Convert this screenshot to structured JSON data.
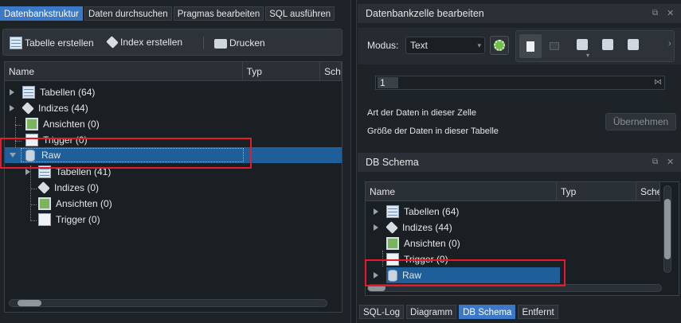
{
  "left": {
    "tabs": [
      "Datenbankstruktur",
      "Daten durchsuchen",
      "Pragmas bearbeiten",
      "SQL ausführen"
    ],
    "toolbar": {
      "create_table": "Tabelle erstellen",
      "create_index": "Index erstellen",
      "print": "Drucken"
    },
    "columns": [
      "Name",
      "Typ",
      "Sch"
    ],
    "tree": {
      "tables": "Tabellen (64)",
      "indices": "Indizes (44)",
      "views": "Ansichten (0)",
      "triggers": "Trigger (0)",
      "raw": "Raw",
      "raw_tables": "Tabellen (41)",
      "raw_indices": "Indizes (0)",
      "raw_views": "Ansichten (0)",
      "raw_triggers": "Trigger (0)"
    }
  },
  "editcell": {
    "title": "Datenbankzelle bearbeiten",
    "mode_label": "Modus:",
    "mode_value": "Text",
    "cell_value": "1",
    "data_type_label": "Art der Daten in dieser Zelle",
    "data_size_label": "Größe der Daten in dieser Tabelle",
    "apply_button": "Übernehmen"
  },
  "schema": {
    "title": "DB Schema",
    "columns": [
      "Name",
      "Typ",
      "Sche"
    ],
    "tree": {
      "tables": "Tabellen (64)",
      "indices": "Indizes (44)",
      "views": "Ansichten (0)",
      "triggers": "Trigger (0)",
      "raw": "Raw"
    }
  },
  "bottom_tabs": [
    "SQL-Log",
    "Diagramm",
    "DB Schema",
    "Entfernt"
  ],
  "colors": {
    "accent": "#3b78c8",
    "selection": "#1f5f99",
    "highlight_box": "#e8192c"
  }
}
